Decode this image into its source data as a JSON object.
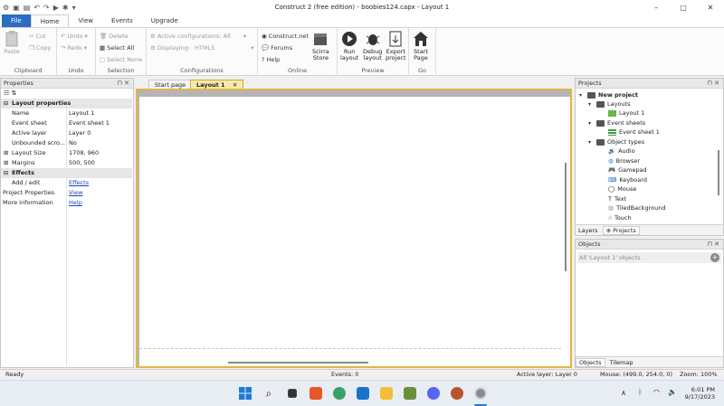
{
  "window": {
    "title": "Construct 2  (free edition) - boobies124.capx - Layout 1",
    "buttons": [
      "–",
      "▢",
      "✕"
    ]
  },
  "ribbon_tabs": [
    "File",
    "Home",
    "View",
    "Events",
    "Upgrade"
  ],
  "ribbon": {
    "clipboard": {
      "label": "Clipboard",
      "paste": "Paste",
      "cut": "Cut",
      "copy": "Copy"
    },
    "undo": {
      "label": "Undo",
      "undo": "Undo",
      "redo": "Redo"
    },
    "selection": {
      "label": "Selection",
      "delete": "Delete",
      "select_all": "Select All",
      "select_none": "Select None"
    },
    "configurations": {
      "label": "Configurations",
      "active": "Active configurations: All",
      "displaying": "Displaying:",
      "displaying_value": "HTML5"
    },
    "online": {
      "label": "Online",
      "construct": "Construct.net",
      "forums": "Forums",
      "help": "Help",
      "store_l1": "Scirra",
      "store_l2": "Store"
    },
    "preview": {
      "label": "Preview",
      "run_l1": "Run",
      "run_l2": "layout",
      "debug_l1": "Debug",
      "debug_l2": "layout",
      "export_l1": "Export",
      "export_l2": "project"
    },
    "go": {
      "label": "Go",
      "start_l1": "Start",
      "start_l2": "Page"
    }
  },
  "properties": {
    "title": "Properties",
    "section_layout": "Layout properties",
    "rows": [
      {
        "k": "Name",
        "v": "Layout 1"
      },
      {
        "k": "Event sheet",
        "v": "Event sheet 1"
      },
      {
        "k": "Active layer",
        "v": "Layer 0"
      },
      {
        "k": "Unbounded scro...",
        "v": "No"
      },
      {
        "k": "Layout Size",
        "v": "1708, 960"
      },
      {
        "k": "Margins",
        "v": "500, 500"
      }
    ],
    "section_effects": "Effects",
    "add_edit": "Add / edit",
    "effects_link": "Effects",
    "project_properties": "Project Properties",
    "view_link": "View",
    "more_information": "More information",
    "help_link": "Help"
  },
  "doc_tabs": {
    "start": "Start page",
    "layout": "Layout 1"
  },
  "projects": {
    "title": "Projects",
    "root": "New project",
    "layouts": "Layouts",
    "layout1": "Layout 1",
    "event_sheets": "Event sheets",
    "event_sheet1": "Event sheet 1",
    "object_types": "Object types",
    "objects": [
      "Audio",
      "Browser",
      "Gamepad",
      "Keyboard",
      "Mouse",
      "Text",
      "TiledBackground",
      "Touch"
    ],
    "tab_layers": "Layers",
    "tab_projects": "Projects"
  },
  "objects_panel": {
    "title": "Objects",
    "filter": "All 'Layout 1' objects",
    "tab_objects": "Objects",
    "tab_tilemap": "Tilemap"
  },
  "status": {
    "ready": "Ready",
    "events": "Events: 0",
    "active_layer": "Active layer: Layer 0",
    "mouse": "Mouse: (499.0, 254.0, 0)",
    "zoom": "Zoom: 100%"
  },
  "taskbar": {
    "time": "6:01 PM",
    "date": "9/17/2023"
  },
  "colors": {
    "accent": "#2b6cc4",
    "layout_tab": "#f7e9a8",
    "frame": "#e0b64a"
  }
}
